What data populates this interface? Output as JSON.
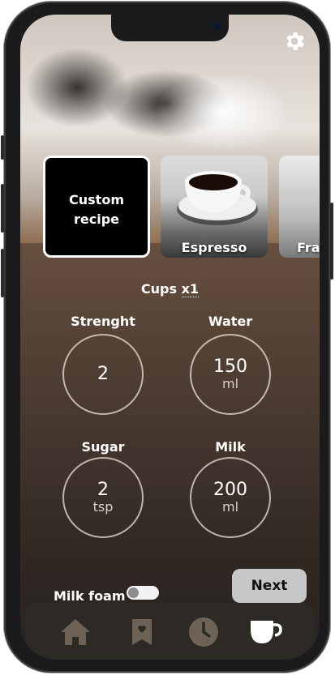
{
  "hero": {
    "settings_icon": "gear-icon"
  },
  "recipes": [
    {
      "label_line1": "Custom",
      "label_line2": "recipe"
    },
    {
      "label": "Espresso"
    },
    {
      "label": "Frappe"
    }
  ],
  "cups": {
    "label": "Cups",
    "count": "x1"
  },
  "params": {
    "strength": {
      "label": "Strenght",
      "value": "2",
      "unit": ""
    },
    "water": {
      "label": "Water",
      "value": "150",
      "unit": "ml"
    },
    "sugar": {
      "label": "Sugar",
      "value": "2",
      "unit": "tsp"
    },
    "milk": {
      "label": "Milk",
      "value": "200",
      "unit": "ml"
    }
  },
  "milk_foam": {
    "label": "Milk foam",
    "enabled": false
  },
  "next_label": "Next",
  "nav": [
    {
      "name": "home",
      "icon": "home-icon",
      "active": false
    },
    {
      "name": "saved",
      "icon": "bookmark-heart-icon",
      "active": false
    },
    {
      "name": "history",
      "icon": "clock-icon",
      "active": false
    },
    {
      "name": "coffee",
      "icon": "coffee-cup-icon",
      "active": true
    }
  ],
  "colors": {
    "nav_inactive": "#6e6256",
    "nav_active": "#ffffff",
    "next_bg": "#c7c7c7"
  }
}
